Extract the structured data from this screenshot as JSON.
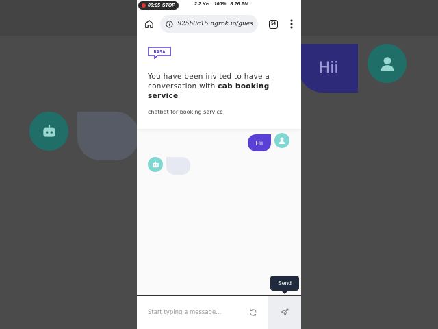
{
  "status_bar": {
    "recording_time": "00:05",
    "recording_stop": "STOP",
    "net_speed": "2.2 K/s",
    "battery": "100%",
    "time": "8:26 PM"
  },
  "browser": {
    "url": "925b0c15.ngrok.io/gues",
    "tab_count": "54"
  },
  "header": {
    "logo_text": "RASA",
    "invite_prefix": "You have been invited to have a conversation with",
    "bot_name": "cab booking service",
    "description": "chatbot for booking service"
  },
  "chat": {
    "user_message": "Hii"
  },
  "composer": {
    "placeholder": "Start typing a message...",
    "send_tooltip": "Send"
  },
  "background": {
    "hii_text": "Hii"
  },
  "colors": {
    "accent": "#5b40d6",
    "avatar": "#7ed7d0",
    "bot_bubble": "#e6e9f2"
  }
}
